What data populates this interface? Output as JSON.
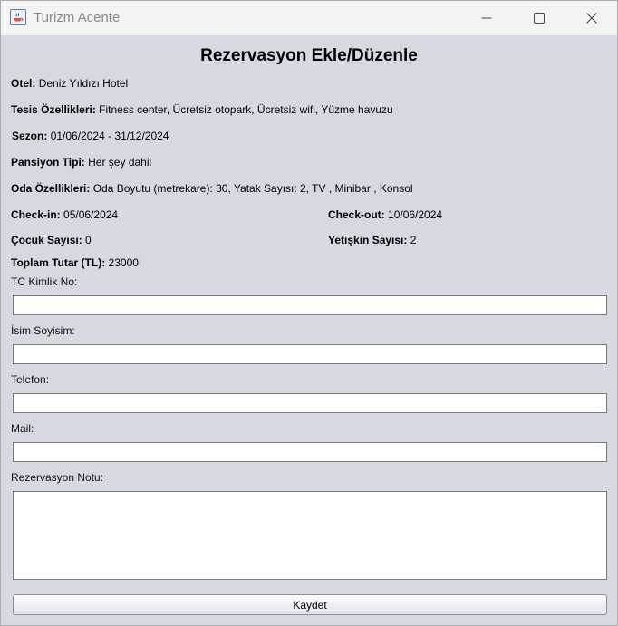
{
  "window": {
    "title": "Turizm Acente"
  },
  "form": {
    "heading": "Rezervasyon Ekle/Düzenle",
    "hotel": {
      "label": "Otel:",
      "value": "Deniz Yıldızı Hotel"
    },
    "facilities": {
      "label": "Tesis Özellikleri:",
      "value": "Fitness center, Ücretsiz otopark, Ücretsiz wifi, Yüzme havuzu"
    },
    "season": {
      "label": "Sezon:",
      "value": "01/06/2024 - 31/12/2024"
    },
    "board": {
      "label": "Pansiyon Tipi:",
      "value": "Her şey dahil"
    },
    "room": {
      "label": "Oda Özellikleri:",
      "value": "Oda Boyutu (metrekare): 30, Yatak Sayısı: 2, TV , Minibar , Konsol"
    },
    "checkin": {
      "label": "Check-in:",
      "value": "05/06/2024"
    },
    "checkout": {
      "label": "Check-out:",
      "value": "10/06/2024"
    },
    "children": {
      "label": "Çocuk Sayısı:",
      "value": "0"
    },
    "adults": {
      "label": "Yetişkin Sayısı:",
      "value": "2"
    },
    "total": {
      "label": "Toplam Tutar (TL):",
      "value": "23000"
    },
    "fields": {
      "tc": {
        "label": "TC Kimlik No:",
        "value": ""
      },
      "name": {
        "label": "İsim Soyisim:",
        "value": ""
      },
      "phone": {
        "label": "Telefon:",
        "value": ""
      },
      "mail": {
        "label": "Mail:",
        "value": ""
      },
      "note": {
        "label": "Rezervasyon Notu:",
        "value": ""
      }
    },
    "save_label": "Kaydet"
  }
}
